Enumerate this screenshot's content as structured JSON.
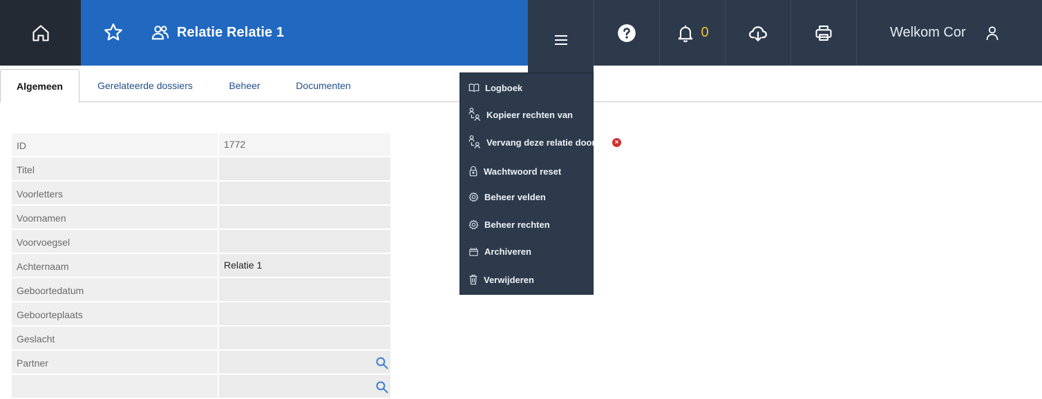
{
  "header": {
    "title": "Relatie Relatie 1",
    "notification_count": "0",
    "welcome": "Welkom Cor"
  },
  "icons": {
    "home": "home-icon",
    "favorite": "star-icon",
    "relation": "users-icon",
    "menu": "hamburger-icon",
    "help": "help-icon",
    "notifications": "bell-icon",
    "download": "cloud-download-icon",
    "print": "printer-icon",
    "user": "user-icon",
    "error": "error-icon",
    "search": "search-icon"
  },
  "colors": {
    "header_bg": "#2c3a4c",
    "title_bg": "#2068c0",
    "home_bg": "#242a34",
    "notification_accent": "#f2c230",
    "error": "#d32f2f",
    "tab_link": "#1f4e8c"
  },
  "tabs": [
    {
      "label": "Algemeen",
      "active": true
    },
    {
      "label": "Gerelateerde dossiers",
      "active": false
    },
    {
      "label": "Beheer",
      "active": false
    },
    {
      "label": "Documenten",
      "active": false
    }
  ],
  "form": {
    "rows": [
      {
        "label": "ID",
        "value": "1772"
      },
      {
        "label": "Titel",
        "value": ""
      },
      {
        "label": "Voorletters",
        "value": ""
      },
      {
        "label": "Voornamen",
        "value": ""
      },
      {
        "label": "Voorvoegsel",
        "value": ""
      },
      {
        "label": "Achternaam",
        "value": "Relatie 1"
      },
      {
        "label": "Geboortedatum",
        "value": ""
      },
      {
        "label": "Geboorteplaats",
        "value": ""
      },
      {
        "label": "Geslacht",
        "value": ""
      },
      {
        "label": "Partner",
        "value": ""
      }
    ]
  },
  "menu": {
    "items": [
      {
        "label": "Logboek",
        "icon": "book-icon"
      },
      {
        "label": "Kopieer rechten van",
        "icon": "users-copy-icon"
      },
      {
        "label": "Vervang deze relatie door",
        "icon": "users-replace-icon"
      },
      {
        "label": "Wachtwoord reset",
        "icon": "lock-icon"
      },
      {
        "label": "Beheer velden",
        "icon": "gear-icon"
      },
      {
        "label": "Beheer rechten",
        "icon": "gear-icon"
      },
      {
        "label": "Archiveren",
        "icon": "archive-icon"
      },
      {
        "label": "Verwijderen",
        "icon": "trash-icon"
      }
    ]
  }
}
